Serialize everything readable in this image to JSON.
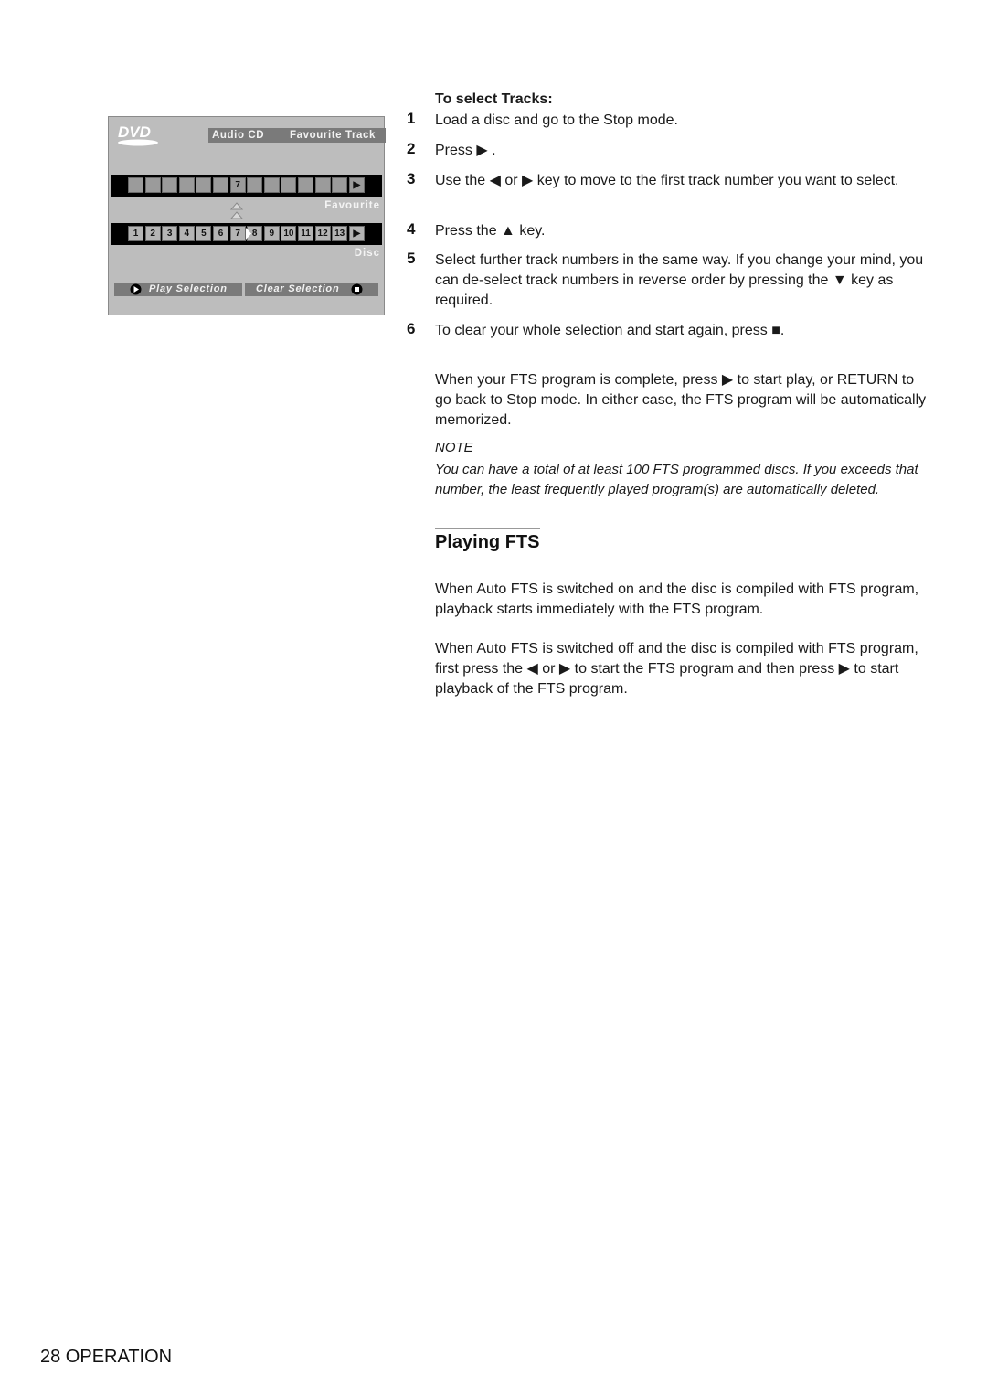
{
  "osd": {
    "logo": "DVD",
    "tab_audio_cd": "Audio CD",
    "tab_favourite_track": "Favourite Track",
    "favourite_label": "Favourite",
    "disc_label": "Disc",
    "favourite_cells": [
      "",
      "",
      "",
      "",
      "",
      "",
      "7",
      "",
      "",
      "",
      "",
      "",
      "",
      "▶"
    ],
    "disc_cells": [
      "1",
      "2",
      "3",
      "4",
      "5",
      "6",
      "7",
      "8",
      "9",
      "10",
      "11",
      "12",
      "13",
      "▶"
    ],
    "selected_track": "7",
    "play_selection": "Play Selection",
    "clear_selection": "Clear Selection"
  },
  "instructions": {
    "subheading": "To select Tracks:",
    "steps": [
      {
        "num": "1",
        "text": "Load a disc and go to the Stop mode."
      },
      {
        "num": "2",
        "text": "Press ▶ ."
      },
      {
        "num": "3",
        "text": "Use the ◀ or ▶ key to move to the first track number you want to select."
      },
      {
        "num": "4",
        "text": "Press the ▲ key."
      },
      {
        "num": "5",
        "text": "Select further track numbers in the same way. If you change your mind, you can de-select track numbers in reverse order by pressing the ▼ key as required."
      },
      {
        "num": "6",
        "text": "To clear your whole selection and start again, press ■."
      }
    ],
    "completion": "When your FTS program is complete, press ▶ to start play, or RETURN to go back to Stop mode. In either case, the FTS program will be automatically memorized.",
    "note_label": "NOTE",
    "note_body": "You can have a total of at least 100 FTS programmed discs. If you exceeds that number, the least frequently played program(s) are automatically deleted."
  },
  "playing_fts": {
    "title": "Playing FTS",
    "para1": "When Auto FTS is switched on and the disc is compiled with FTS program, playback starts immediately with the FTS program.",
    "para2": "When Auto FTS is switched off and the disc is compiled with FTS program, first press the ◀ or ▶ to start the FTS program and then press ▶ to start playback of the FTS program."
  },
  "footer": {
    "page_label": "28 OPERATION"
  }
}
